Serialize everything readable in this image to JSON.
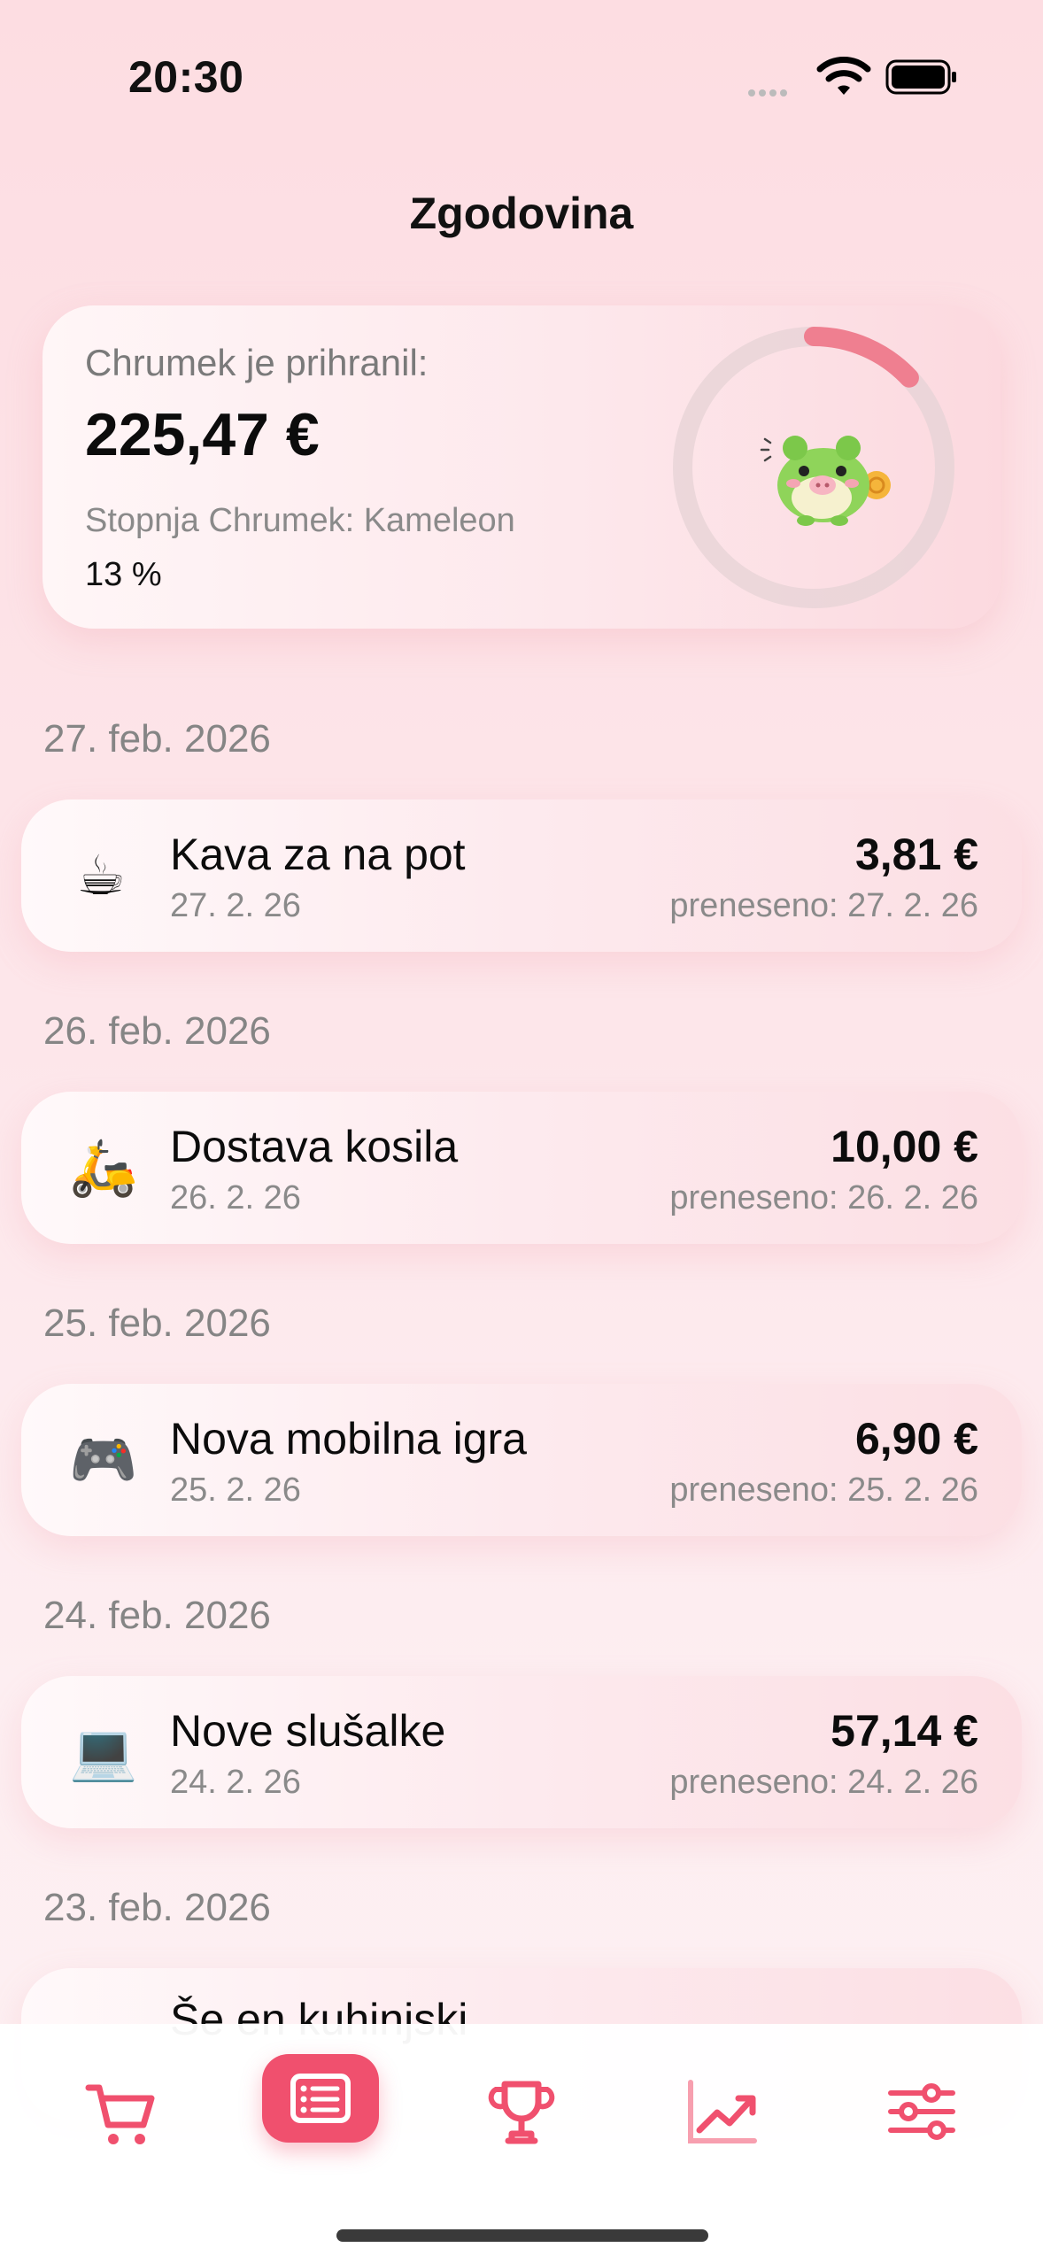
{
  "status": {
    "time": "20:30"
  },
  "header": {
    "title": "Zgodovina"
  },
  "summary": {
    "saved_label": "Chrumek je prihranil:",
    "saved_amount": "225,47 €",
    "level_label": "Stopnja Chrumek: Kameleon",
    "level_percent": "13 %",
    "progress_fraction": 0.13
  },
  "history": [
    {
      "date_header": "27. feb. 2026",
      "icon": "☕",
      "icon_name": "coffee-icon",
      "name": "Kava za na pot",
      "date": "27. 2. 26",
      "amount": "3,81 €",
      "transferred": "preneseno: 27. 2. 26"
    },
    {
      "date_header": "26. feb. 2026",
      "icon": "🛵",
      "icon_name": "scooter-icon",
      "name": "Dostava kosila",
      "date": "26. 2. 26",
      "amount": "10,00 €",
      "transferred": "preneseno: 26. 2. 26"
    },
    {
      "date_header": "25. feb. 2026",
      "icon": "🎮",
      "icon_name": "gamepad-icon",
      "name": "Nova mobilna igra",
      "date": "25. 2. 26",
      "amount": "6,90 €",
      "transferred": "preneseno: 25. 2. 26"
    },
    {
      "date_header": "24. feb. 2026",
      "icon": "💻",
      "icon_name": "laptop-icon",
      "name": "Nove slušalke",
      "date": "24. 2. 26",
      "amount": "57,14 €",
      "transferred": "preneseno: 24. 2. 26"
    },
    {
      "date_header": "23. feb. 2026",
      "icon": "",
      "icon_name": "",
      "name": "Še en kuhinjski",
      "date": "",
      "amount": "",
      "transferred": ""
    }
  ],
  "tabbar": {
    "accent": "#f0506e",
    "tabs": [
      {
        "icon": "cart-icon"
      },
      {
        "icon": "list-icon",
        "active": true
      },
      {
        "icon": "trophy-icon"
      },
      {
        "icon": "chart-icon"
      },
      {
        "icon": "sliders-icon"
      }
    ]
  }
}
